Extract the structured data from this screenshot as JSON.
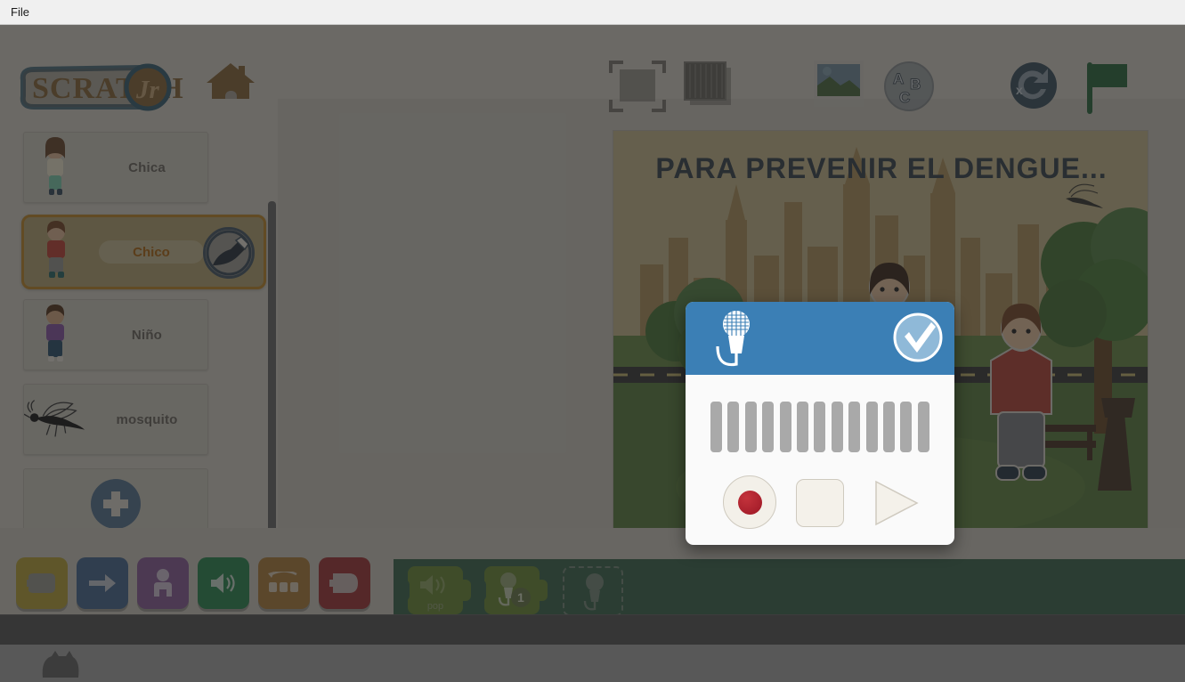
{
  "menubar": {
    "items": [
      {
        "label": "File"
      }
    ]
  },
  "header": {
    "logo_text": "SCRATCH Jr",
    "home_icon": "home-icon",
    "toolbar": [
      {
        "name": "fullscreen-icon",
        "label": "Pantalla completa"
      },
      {
        "name": "pages-icon",
        "label": "Paginas"
      },
      {
        "name": "background-icon",
        "label": "Fondo"
      },
      {
        "name": "text-icon",
        "label": "ABC"
      },
      {
        "name": "reset-icon",
        "label": "Reiniciar"
      },
      {
        "name": "green-flag-icon",
        "label": "Bandera verde"
      }
    ]
  },
  "sprites": {
    "items": [
      {
        "name": "Chica",
        "thumb": "girl-sprite",
        "selected": false
      },
      {
        "name": "Chico",
        "thumb": "boy-sprite",
        "selected": true
      },
      {
        "name": "Niño",
        "thumb": "child-sprite",
        "selected": false
      },
      {
        "name": "mosquito",
        "thumb": "mosquito-sprite",
        "selected": false
      }
    ],
    "paint_button": "paint-brush-icon",
    "add_button": "plus-icon",
    "accent_selected": "#c08a2e",
    "selected_text_color": "#b06a17"
  },
  "stage": {
    "title": "PARA PREVENIR EL DENGUE...",
    "title_color": "#3b4550",
    "background_name": "city-park-background",
    "characters": [
      "girl-sprite",
      "child-purple-sprite",
      "boy-red-sprite",
      "mosquito-sprite"
    ]
  },
  "palette": {
    "categories": [
      {
        "name": "triggers",
        "color": "#b9a53c",
        "icon": "start-block-icon"
      },
      {
        "name": "motion",
        "color": "#4a6b93",
        "icon": "arrow-right-icon"
      },
      {
        "name": "looks",
        "color": "#8d5f9c",
        "icon": "person-icon"
      },
      {
        "name": "sound",
        "color": "#2f8a55",
        "icon": "speaker-icon"
      },
      {
        "name": "control",
        "color": "#b1803f",
        "icon": "repeat-icon"
      },
      {
        "name": "end",
        "color": "#a2383a",
        "icon": "end-block-icon"
      }
    ]
  },
  "script": {
    "blocks": [
      {
        "name": "play-pop-sound-block",
        "label": "pop",
        "icon": "speaker-icon"
      },
      {
        "name": "play-recorded-sound-block",
        "label": "1",
        "icon": "microphone-icon"
      }
    ],
    "placeholder": "record-sound-placeholder",
    "background_color": "#3e6a51"
  },
  "record_dialog": {
    "title_icon": "microphone-icon",
    "ok_button": "checkmark-icon",
    "header_color": "#3b7fb5",
    "waveform_bars": 13,
    "waveform_color": "#a9a9a9",
    "controls": [
      {
        "name": "record-button",
        "label": "Grabar"
      },
      {
        "name": "stop-button",
        "label": "Detener"
      },
      {
        "name": "play-button",
        "label": "Reproducir"
      }
    ],
    "record_dot_color": "#9c1725"
  },
  "bottom": {
    "cat_icon": "scratchjr-cat-icon"
  }
}
